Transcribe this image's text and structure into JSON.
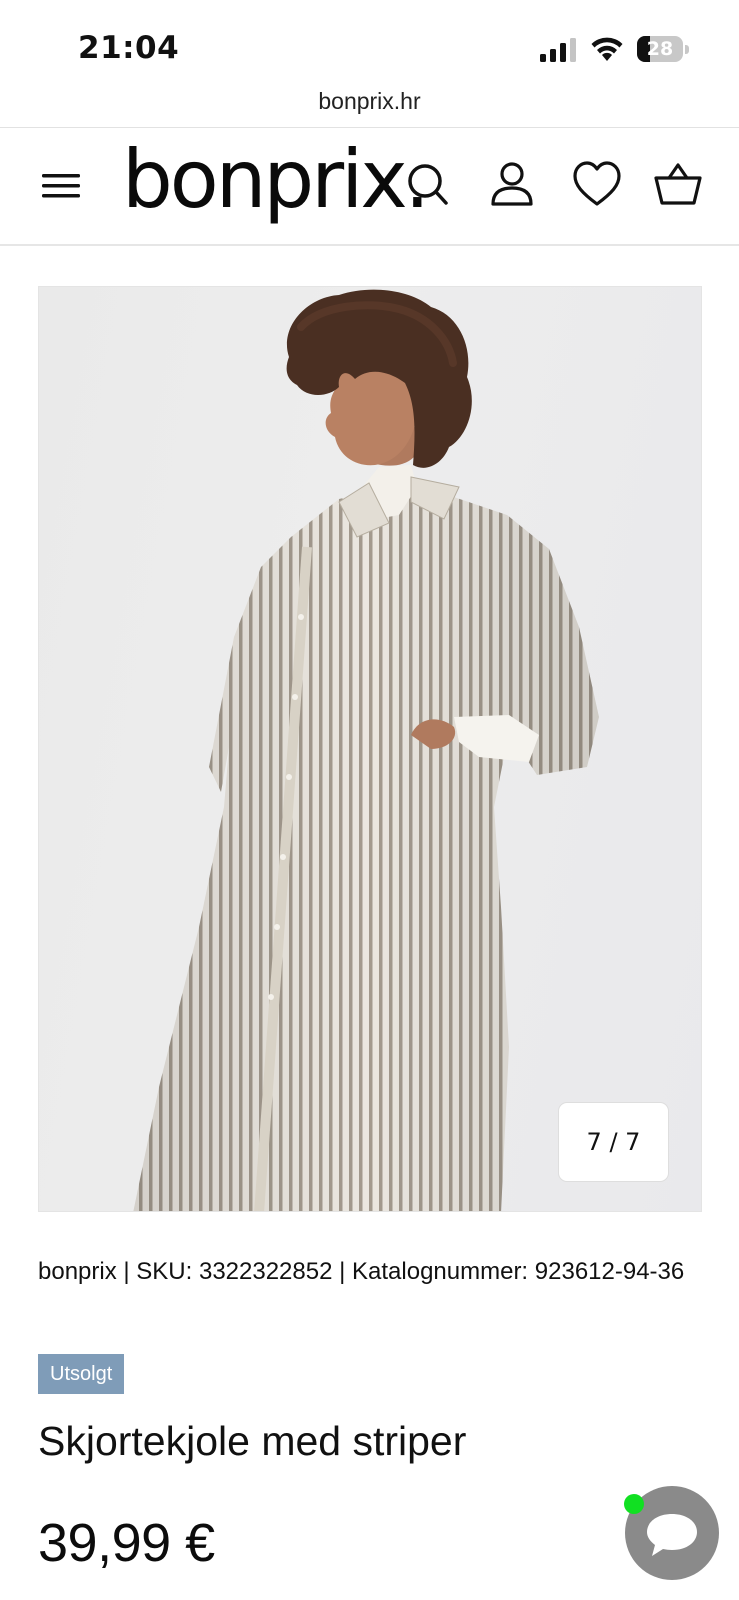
{
  "status_bar": {
    "time": "21:04",
    "battery_percent": "28",
    "battery_level": 0.28
  },
  "browser": {
    "url": "bonprix.hr"
  },
  "header": {
    "logo_text": "bonprix.",
    "icons": [
      "menu-icon",
      "search-icon",
      "account-icon",
      "wishlist-heart-icon",
      "cart-basket-icon"
    ]
  },
  "gallery": {
    "counter": "7 / 7"
  },
  "product": {
    "meta_line": "bonprix | SKU: 3322322852 | Katalognummer: 923612-94-36",
    "badge": "Utsolgt",
    "badge_color": "#7f9cb8",
    "title": "Skjortekjole med striper",
    "price": "39,99 €"
  },
  "chat": {
    "icon": "chat-bubble-icon",
    "online_dot_color": "#11e022"
  }
}
